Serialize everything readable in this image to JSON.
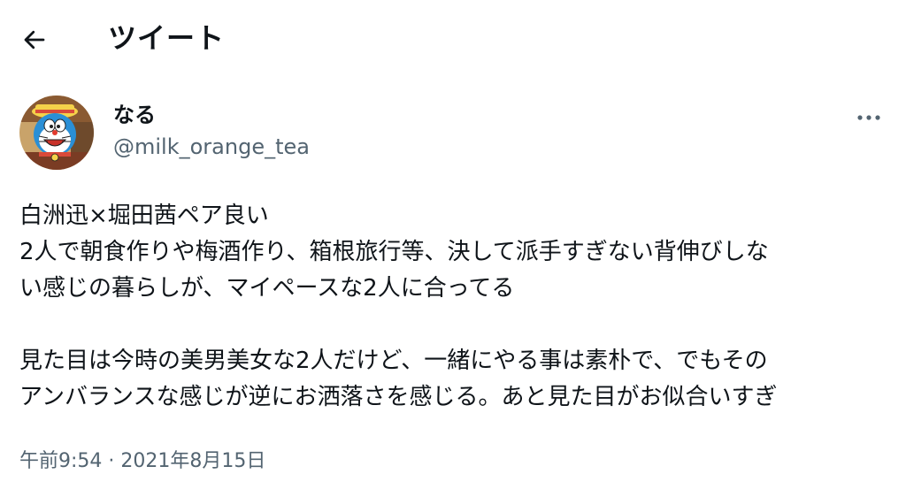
{
  "header": {
    "title": "ツイート",
    "back_icon": "arrow-left-icon"
  },
  "author": {
    "display_name": "なる",
    "handle": "@milk_orange_tea",
    "avatar_icon": "doraemon-avatar",
    "more_icon": "more-horizontal-icon"
  },
  "tweet": {
    "lines": [
      "白洲迅×堀田茜ペア良い",
      "2人で朝食作りや梅酒作り、箱根旅行等、決して派手すぎない背伸びしな",
      "い感じの暮らしが、マイペースな2人に合ってる",
      "",
      "見た目は今時の美男美女な2人だけど、一緒にやる事は素朴で、でもその",
      "アンバランスな感じが逆にお洒落さを感じる。あと見た目がお似合いすぎ"
    ],
    "timestamp": "午前9:54 · 2021年8月15日"
  },
  "colors": {
    "text": "#0f1419",
    "secondary": "#536471"
  }
}
